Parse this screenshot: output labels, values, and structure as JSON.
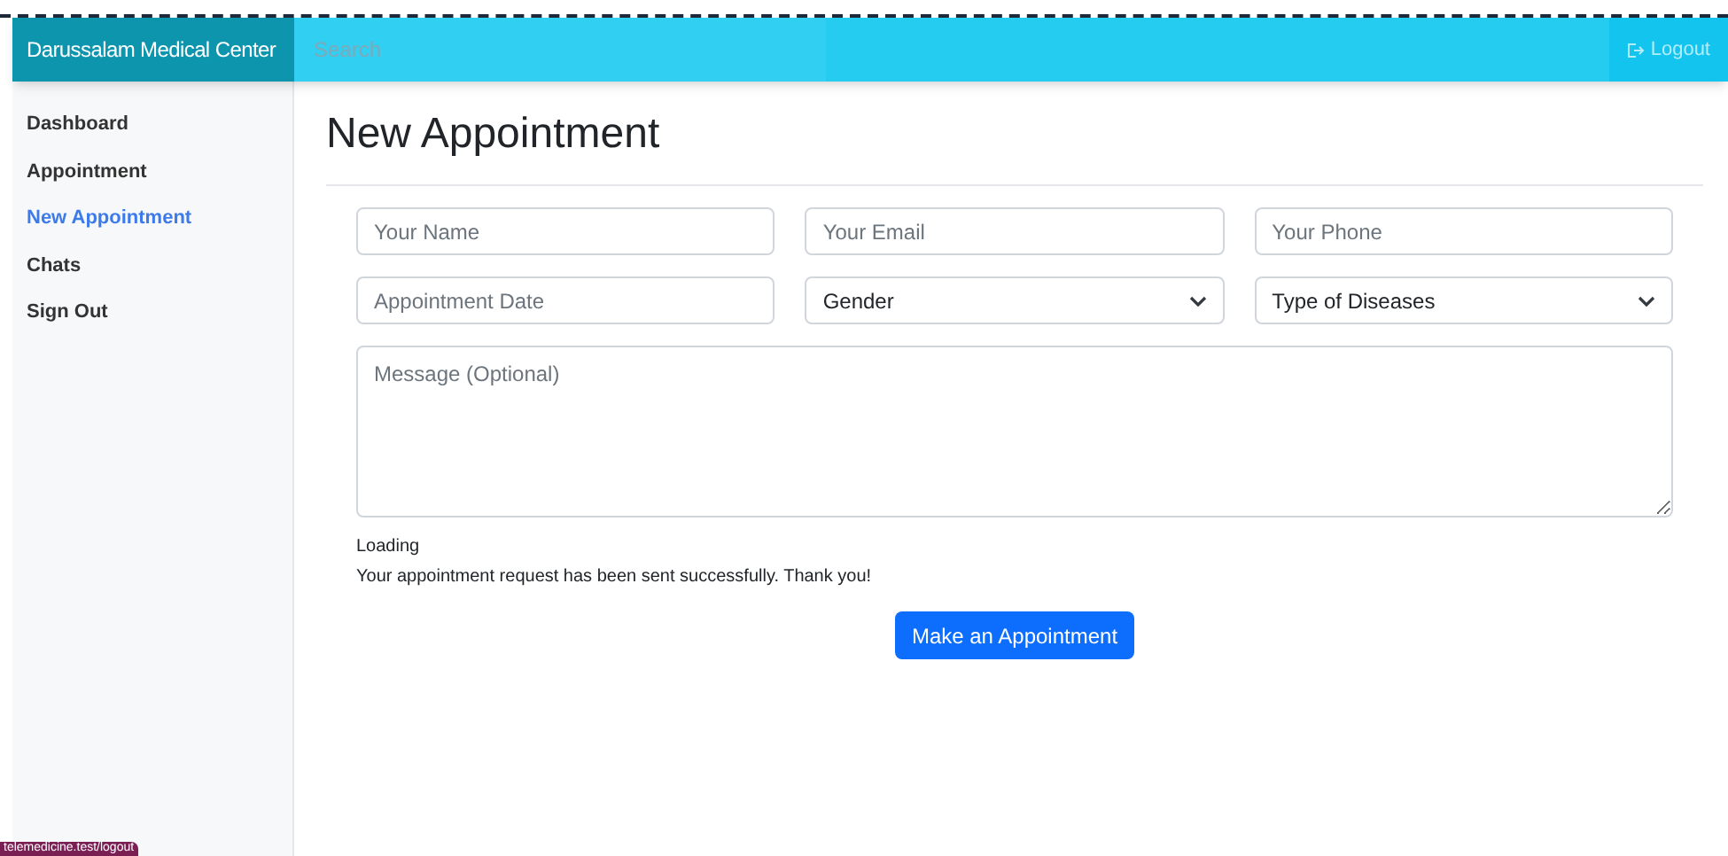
{
  "brand": "Darussalam Medical Center",
  "search": {
    "placeholder": "Search"
  },
  "logout_button": {
    "label": "Logout"
  },
  "sidebar": {
    "items": [
      {
        "label": "Dashboard",
        "selected": false
      },
      {
        "label": "Appointment",
        "selected": false
      },
      {
        "label": "New Appointment",
        "selected": true
      },
      {
        "label": "Chats",
        "selected": false
      },
      {
        "label": "Sign Out",
        "selected": false
      }
    ]
  },
  "page_title": "New Appointment",
  "form": {
    "fields": [
      {
        "kind": "input",
        "placeholder": "Your Name"
      },
      {
        "kind": "input",
        "placeholder": "Your Email"
      },
      {
        "kind": "input",
        "placeholder": "Your Phone"
      },
      {
        "kind": "input",
        "placeholder": "Appointment Date"
      },
      {
        "kind": "select",
        "value": "Gender"
      },
      {
        "kind": "select",
        "value": "Type of Diseases"
      }
    ],
    "message": {
      "placeholder": "Message (Optional)"
    },
    "loading": "Loading",
    "success": "Your appointment request has been sent successfully. Thank you!",
    "submit": "Make an Appointment"
  },
  "status_bar": {
    "url": "telemedicine.test/logout"
  }
}
